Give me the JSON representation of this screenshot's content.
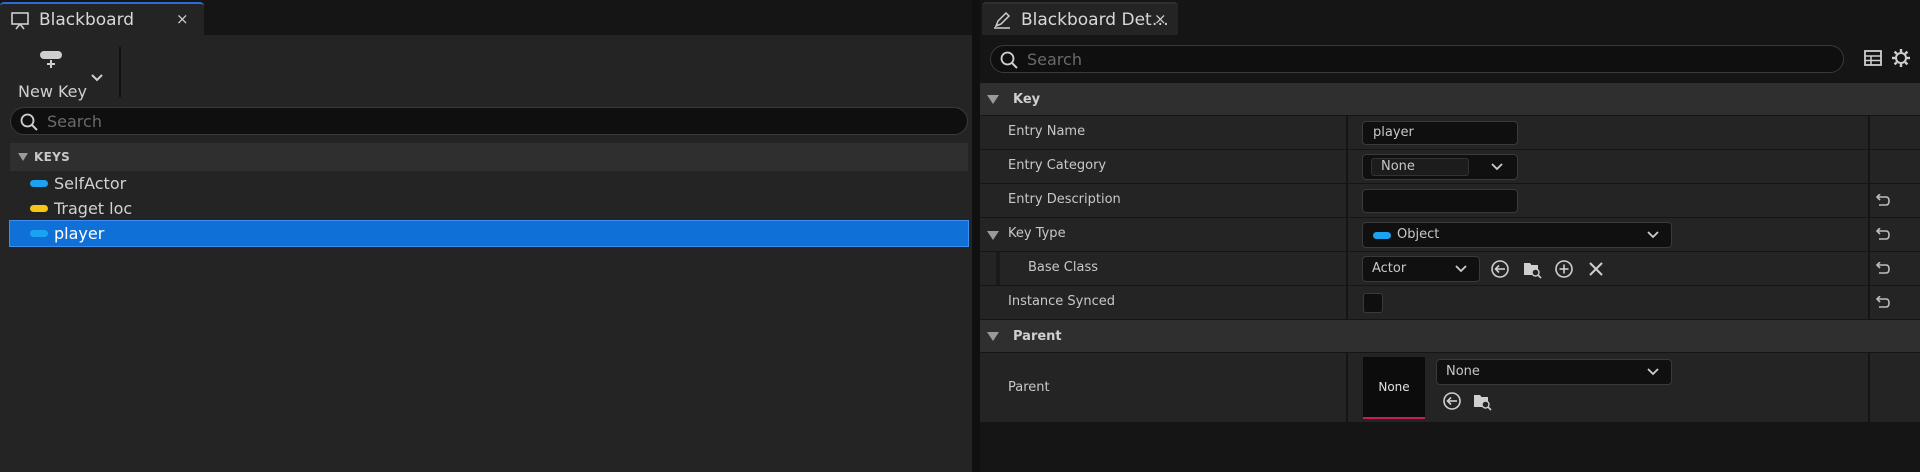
{
  "left_panel": {
    "tab": {
      "title": "Blackboard",
      "close": "×"
    },
    "toolbar": {
      "new_key_label": "New Key"
    },
    "search": {
      "placeholder": "Search"
    },
    "keys_header": "KEYS",
    "keys": [
      {
        "label": "SelfActor",
        "color": "#1aa3f2"
      },
      {
        "label": "Traget loc",
        "color": "#f5c518"
      },
      {
        "label": "player",
        "color": "#1aa3f2",
        "selected": true
      }
    ]
  },
  "right_panel": {
    "tab": {
      "title": "Blackboard Det…",
      "close": "×"
    },
    "search": {
      "placeholder": "Search"
    },
    "categories": {
      "key": "Key",
      "parent": "Parent"
    },
    "rows": {
      "entry_name": {
        "label": "Entry Name",
        "value": "player"
      },
      "entry_category": {
        "label": "Entry Category",
        "value": "None"
      },
      "entry_description": {
        "label": "Entry Description",
        "value": ""
      },
      "key_type": {
        "label": "Key Type",
        "value": "Object"
      },
      "base_class": {
        "label": "Base Class",
        "value": "Actor"
      },
      "instance_synced": {
        "label": "Instance Synced",
        "checked": false
      },
      "parent": {
        "label": "Parent",
        "thumbnail": "None",
        "value": "None"
      }
    }
  },
  "colors": {
    "selection": "#0f70d8",
    "object_pin": "#1aa3f2",
    "vector_pin": "#f5c518",
    "thumbnail_underline": "#c41e54"
  }
}
